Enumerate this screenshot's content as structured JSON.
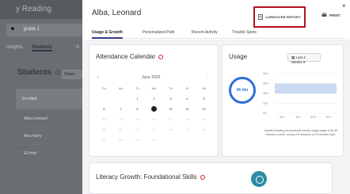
{
  "background_app": {
    "title": "y Reading",
    "grade": "grade 1",
    "tabs": [
      "Insights",
      "Students",
      "S"
    ],
    "students_title": "Students",
    "overview_btn": "Overv",
    "table_header": "Enrolled",
    "rows": [
      "Alba Leonard",
      "Aria Harry",
      "Eli Holt"
    ],
    "accent_color": "#f39c28"
  },
  "modal": {
    "student_name": "Alba, Leonard",
    "caregiver_report_label": "CAREGIVER REPORT",
    "print_label": "PRINT",
    "close_symbol": "×",
    "tabs": [
      {
        "label": "Usage & Growth",
        "active": true
      },
      {
        "label": "Personalized Path",
        "active": false
      },
      {
        "label": "Recent Activity",
        "active": false
      },
      {
        "label": "Trouble Spots",
        "active": false
      }
    ]
  },
  "attendance": {
    "title": "Attendance Calendar",
    "prev": "‹",
    "next": "›",
    "month": "June 2025",
    "weekdays": [
      "Su",
      "Mo",
      "Tu",
      "We",
      "Th",
      "Fr",
      "Sa"
    ],
    "weeks": [
      [
        "",
        "",
        "1",
        "2",
        "3",
        "4",
        "5"
      ],
      [
        "6",
        "7",
        "8",
        "9",
        "10",
        "11",
        "12"
      ],
      [
        "13",
        "14",
        "15",
        "16",
        "17",
        "18",
        "19"
      ],
      [
        "20",
        "21",
        "22",
        "23",
        "24",
        "25",
        "26"
      ],
      [
        "27",
        "28",
        "29",
        "30",
        "",
        "",
        ""
      ]
    ],
    "today": "9"
  },
  "usage": {
    "title": "Usage",
    "dropdown_value": "Last 4 Weeks",
    "total": "0h 0m",
    "y_ticks": [
      "60m",
      "45m",
      "30m",
      "15m",
      "0m"
    ],
    "x_ticks": [
      "5/27",
      "6/3",
      "6/10",
      "6/17"
    ],
    "note": "Amplify Reading recommends weekly usage target of 30-45 minutes a week, across 2-5 sessions of 15 minutes each."
  },
  "chart_data": {
    "type": "bar",
    "categories": [
      "5/27",
      "6/3",
      "6/10",
      "6/17"
    ],
    "values": [
      0,
      0,
      0,
      0
    ],
    "title": "Usage",
    "ylabel": "",
    "ylim": [
      0,
      60
    ]
  },
  "literacy": {
    "title": "Literacy Growth: Foundational Skills"
  }
}
